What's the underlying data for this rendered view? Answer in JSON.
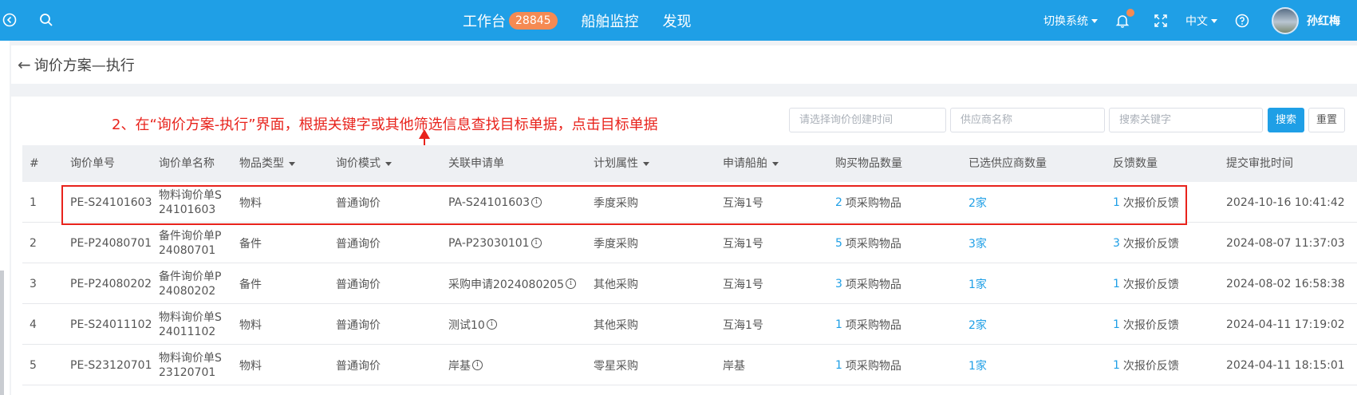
{
  "topbar": {
    "nav": [
      {
        "label": "工作台",
        "badge": "28845"
      },
      {
        "label": "船舶监控"
      },
      {
        "label": "发现"
      }
    ],
    "switch_system": "切换系统",
    "language": "中文",
    "username": "孙红梅"
  },
  "page": {
    "title": "询价方案—执行"
  },
  "annotation": "2、在“询价方案-执行”界面，根据关键字或其他筛选信息查找目标单据，点击目标单据",
  "filters": {
    "date_placeholder": "请选择询价创建时间",
    "supplier_placeholder": "供应商名称",
    "keyword_placeholder": "搜索关键字",
    "search_label": "搜索",
    "reset_label": "重置"
  },
  "table": {
    "headers": [
      "#",
      "询价单号",
      "询价单名称",
      "物品类型",
      "询价模式",
      "关联申请单",
      "计划属性",
      "申请船舶",
      "购买物品数量",
      "已选供应商数量",
      "反馈数量",
      "提交审批时间"
    ],
    "rows": [
      {
        "idx": "1",
        "code": "PE-S24101603",
        "name": "物料询价单S24101603",
        "type": "物料",
        "mode": "普通询价",
        "request": "PA-S24101603",
        "plan": "季度采购",
        "ship": "互海1号",
        "qty_num": "2",
        "qty_text": "项采购物品",
        "suppliers": "2家",
        "fb_num": "1",
        "fb_text": "次报价反馈",
        "time": "2024-10-16 10:41:42"
      },
      {
        "idx": "2",
        "code": "PE-P24080701",
        "name": "备件询价单P24080701",
        "type": "备件",
        "mode": "普通询价",
        "request": "PA-P23030101",
        "plan": "季度采购",
        "ship": "互海1号",
        "qty_num": "5",
        "qty_text": "项采购物品",
        "suppliers": "3家",
        "fb_num": "3",
        "fb_text": "次报价反馈",
        "time": "2024-08-07 11:37:03"
      },
      {
        "idx": "3",
        "code": "PE-P24080202",
        "name": "备件询价单P24080202",
        "type": "备件",
        "mode": "普通询价",
        "request": "采购申请2024080205",
        "plan": "其他采购",
        "ship": "互海1号",
        "qty_num": "3",
        "qty_text": "项采购物品",
        "suppliers": "1家",
        "fb_num": "1",
        "fb_text": "次报价反馈",
        "time": "2024-08-02 16:58:38"
      },
      {
        "idx": "4",
        "code": "PE-S24011102",
        "name": "物料询价单S24011102",
        "type": "物料",
        "mode": "普通询价",
        "request": "测试10",
        "plan": "其他采购",
        "ship": "互海1号",
        "qty_num": "1",
        "qty_text": "项采购物品",
        "suppliers": "2家",
        "fb_num": "1",
        "fb_text": "次报价反馈",
        "time": "2024-04-11 17:19:02"
      },
      {
        "idx": "5",
        "code": "PE-S23120701",
        "name": "物料询价单S23120701",
        "type": "物料",
        "mode": "普通询价",
        "request": "岸基",
        "plan": "零星采购",
        "ship": "岸基",
        "qty_num": "1",
        "qty_text": "项采购物品",
        "suppliers": "1家",
        "fb_num": "1",
        "fb_text": "次报价反馈",
        "time": "2024-04-11 18:15:01"
      }
    ]
  }
}
